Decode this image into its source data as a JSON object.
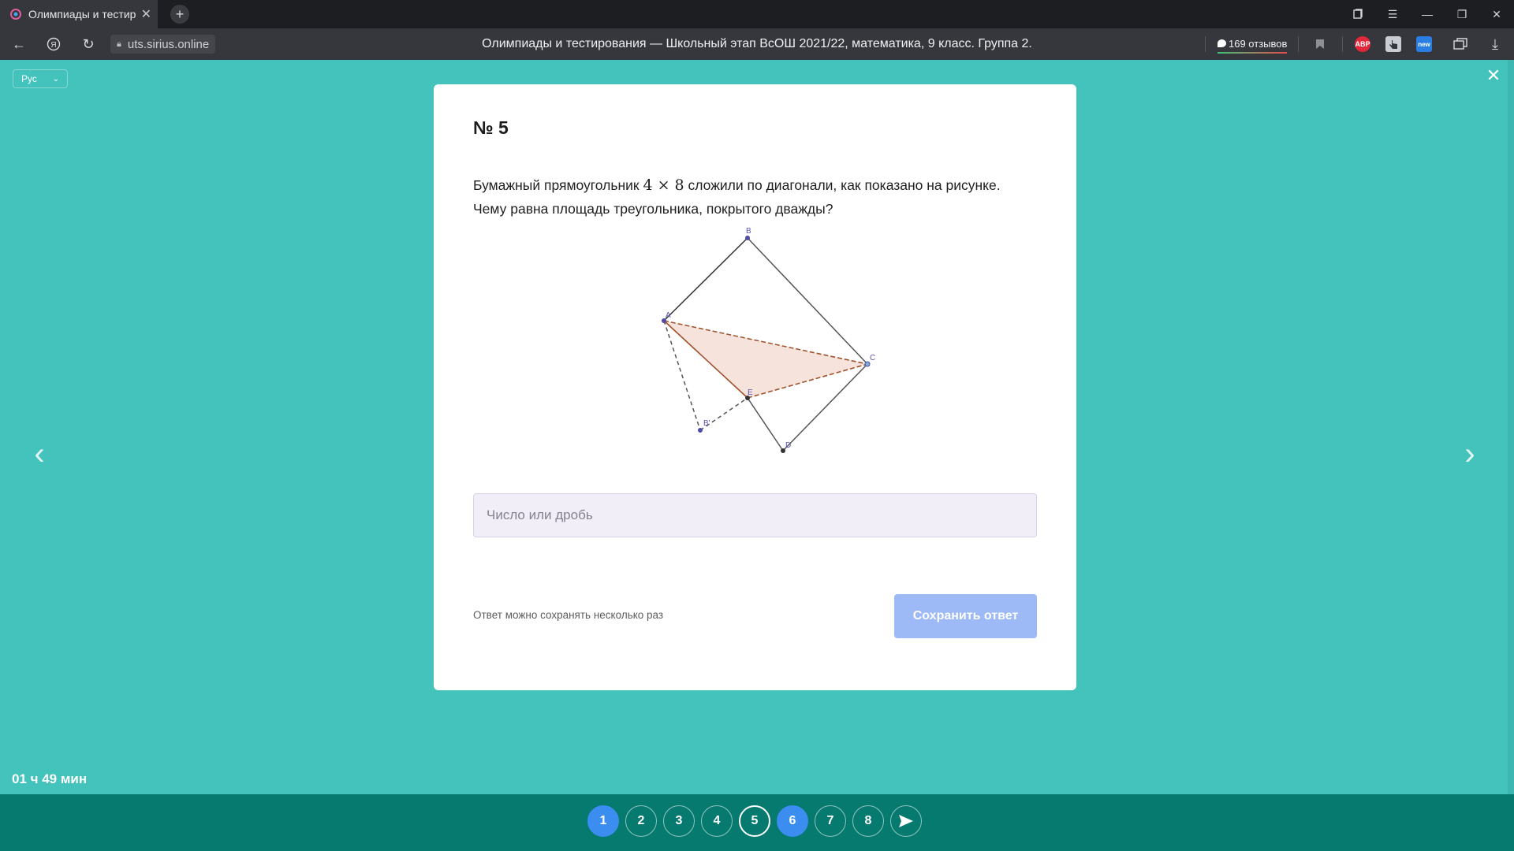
{
  "browser": {
    "tab_title": "Олимпиады и тестирования",
    "url": "uts.sirius.online",
    "page_title": "Олимпиады и тестирования — Школьный этап ВсОШ 2021/22, математика, 9 класс. Группа 2.",
    "reviews": "169 отзывов",
    "ext_abp": "ABP",
    "ext_new": "new"
  },
  "page": {
    "language": "Рус",
    "timer": "01 ч 49 мин"
  },
  "task": {
    "number": "№ 5",
    "text_before": "Бумажный прямоугольник ",
    "math": "4 × 8",
    "text_after": " сложили по диагонали, как показано на рисунке. Чему равна площадь треугольника, покрытого дважды?",
    "figure_labels": {
      "A": "A",
      "B": "B",
      "C": "C",
      "D": "D",
      "E": "E",
      "B2": "B'"
    },
    "answer_placeholder": "Число или дробь",
    "hint": "Ответ можно сохранять несколько раз",
    "save_label": "Сохранить ответ"
  },
  "questions": [
    {
      "label": "1",
      "state": "done"
    },
    {
      "label": "2",
      "state": "open"
    },
    {
      "label": "3",
      "state": "open"
    },
    {
      "label": "4",
      "state": "open"
    },
    {
      "label": "5",
      "state": "current"
    },
    {
      "label": "6",
      "state": "done"
    },
    {
      "label": "7",
      "state": "open"
    },
    {
      "label": "8",
      "state": "open"
    }
  ],
  "colors": {
    "page_bg": "#44c3bd",
    "bottom_bar": "#077a70",
    "done_question": "#3b8df0",
    "save_button": "#9dbaf7",
    "triangle_fill": "#f6e3dc",
    "triangle_stroke": "#a0522d"
  }
}
